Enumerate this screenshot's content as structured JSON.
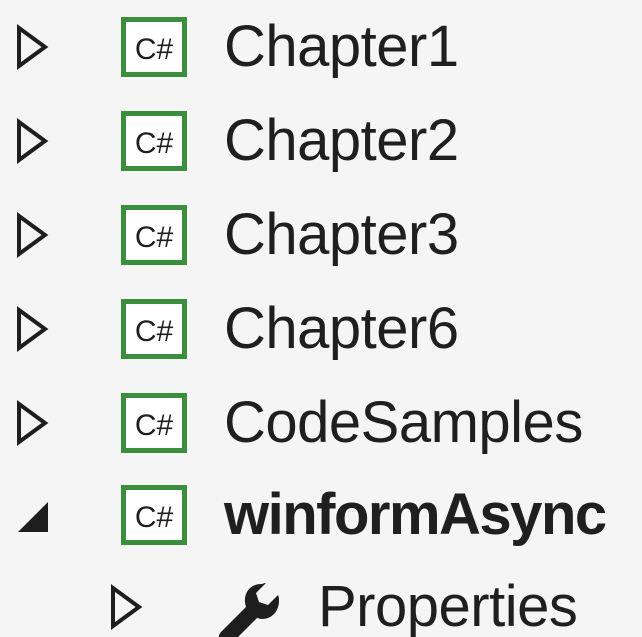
{
  "tree": {
    "items": [
      {
        "label": "Chapter1",
        "icon": "csharp-project-icon",
        "expander": "collapsed"
      },
      {
        "label": "Chapter2",
        "icon": "csharp-project-icon",
        "expander": "collapsed"
      },
      {
        "label": "Chapter3",
        "icon": "csharp-project-icon",
        "expander": "collapsed"
      },
      {
        "label": "Chapter6",
        "icon": "csharp-project-icon",
        "expander": "collapsed"
      },
      {
        "label": "CodeSamples",
        "icon": "csharp-project-icon",
        "expander": "collapsed"
      },
      {
        "label": "winformAsync",
        "icon": "csharp-project-icon",
        "expander": "expanded",
        "bold": true
      },
      {
        "label": "Properties",
        "icon": "wrench-icon",
        "expander": "collapsed"
      }
    ],
    "icon_text": "C#"
  },
  "colors": {
    "background": "#f5f5f5",
    "text": "#1f1f1f",
    "csharp_icon_border": "#3b8e3b",
    "expander": "#1e1e1e"
  }
}
